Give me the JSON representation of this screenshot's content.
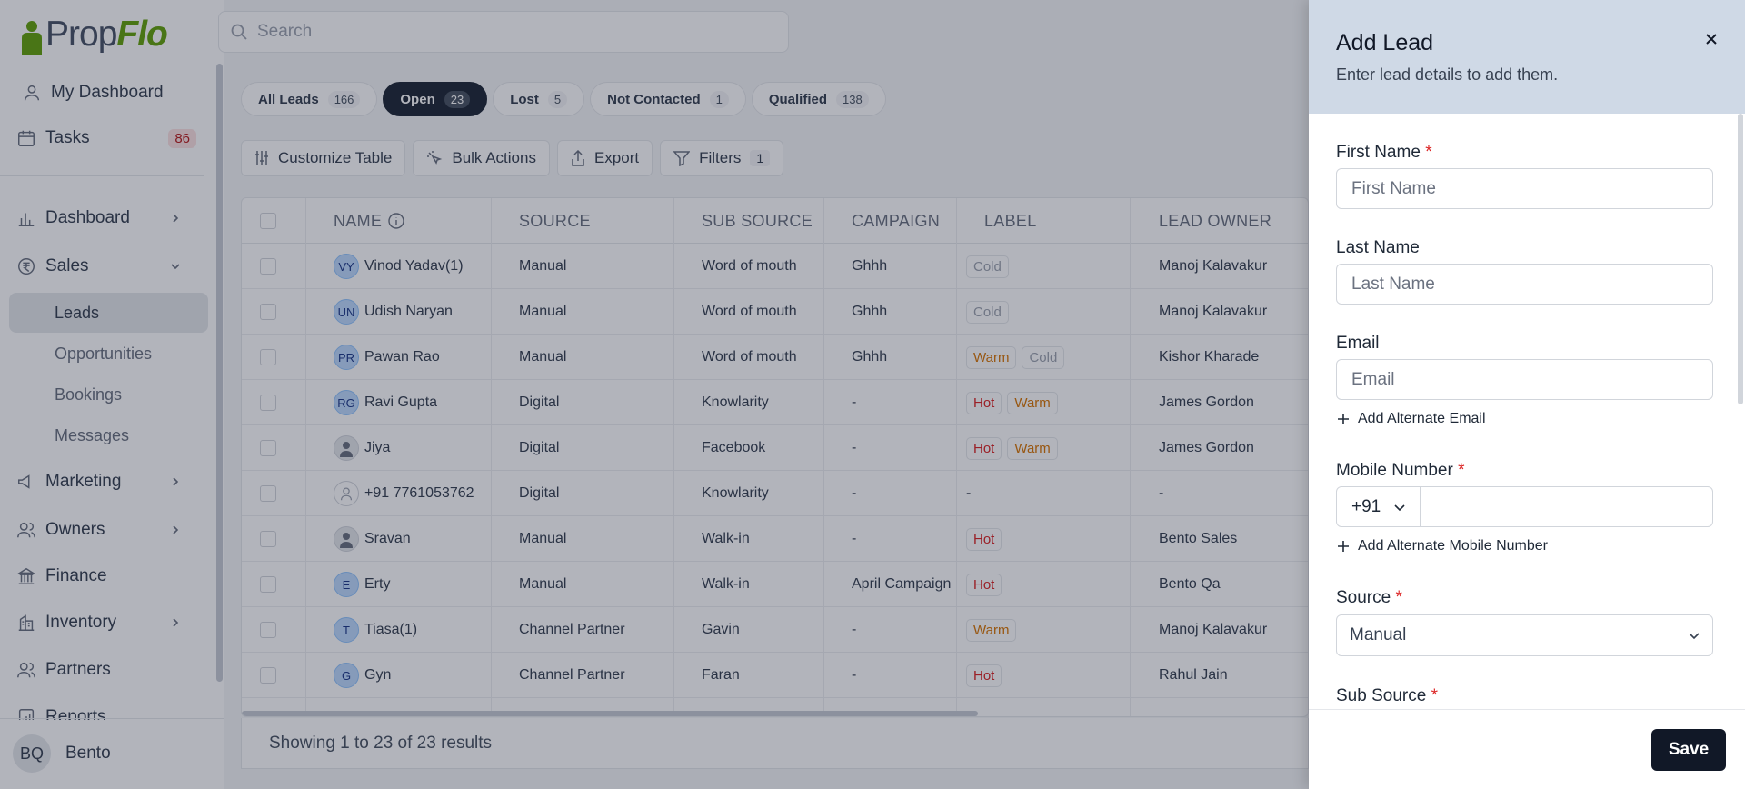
{
  "app": {
    "logo_prop": "Prop",
    "logo_flo": "Flo"
  },
  "search": {
    "placeholder": "Search"
  },
  "sidebar": {
    "my_dashboard": "My Dashboard",
    "tasks": "Tasks",
    "tasks_count": "86",
    "dashboard": "Dashboard",
    "sales": "Sales",
    "sales_sub": [
      "Leads",
      "Opportunities",
      "Bookings",
      "Messages"
    ],
    "marketing": "Marketing",
    "owners": "Owners",
    "finance": "Finance",
    "inventory": "Inventory",
    "partners": "Partners",
    "reports": "Reports",
    "user_initials": "BQ",
    "user_name": "Bento"
  },
  "tabs": [
    {
      "label": "All Leads",
      "count": "166",
      "active": false
    },
    {
      "label": "Open",
      "count": "23",
      "active": true
    },
    {
      "label": "Lost",
      "count": "5",
      "active": false
    },
    {
      "label": "Not Contacted",
      "count": "1",
      "active": false
    },
    {
      "label": "Qualified",
      "count": "138",
      "active": false
    }
  ],
  "toolbar": {
    "customize": "Customize Table",
    "bulk": "Bulk Actions",
    "export": "Export",
    "filters": "Filters",
    "filters_count": "1"
  },
  "table": {
    "headers": [
      "NAME",
      "SOURCE",
      "SUB SOURCE",
      "CAMPAIGN",
      "LABEL",
      "LEAD OWNER"
    ],
    "rows": [
      {
        "initials": "VY",
        "name": "Vinod Yadav(1)",
        "source": "Manual",
        "sub_source": "Word of mouth",
        "campaign": "Ghhh",
        "labels": [
          "Cold"
        ],
        "owner": "Manoj Kalavakur"
      },
      {
        "initials": "UN",
        "name": "Udish Naryan",
        "source": "Manual",
        "sub_source": "Word of mouth",
        "campaign": "Ghhh",
        "labels": [
          "Cold"
        ],
        "owner": "Manoj Kalavakur"
      },
      {
        "initials": "PR",
        "name": "Pawan Rao",
        "source": "Manual",
        "sub_source": "Word of mouth",
        "campaign": "Ghhh",
        "labels": [
          "Warm",
          "Cold"
        ],
        "owner": "Kishor Kharade"
      },
      {
        "initials": "RG",
        "name": "Ravi Gupta",
        "source": "Digital",
        "sub_source": "Knowlarity",
        "campaign": "-",
        "labels": [
          "Hot",
          "Warm"
        ],
        "owner": "James Gordon"
      },
      {
        "initials": "",
        "avatar": "photo",
        "name": "Jiya",
        "source": "Digital",
        "sub_source": "Facebook",
        "campaign": "-",
        "labels": [
          "Hot",
          "Warm"
        ],
        "owner": "James Gordon"
      },
      {
        "initials": "",
        "avatar": "person",
        "name": "+91 7761053762",
        "source": "Digital",
        "sub_source": "Knowlarity",
        "campaign": "-",
        "labels": [],
        "label_text": "-",
        "owner": "-"
      },
      {
        "initials": "",
        "avatar": "photo",
        "name": "Sravan",
        "source": "Manual",
        "sub_source": "Walk-in",
        "campaign": "-",
        "labels": [
          "Hot"
        ],
        "owner": "Bento Sales"
      },
      {
        "initials": "E",
        "name": "Erty",
        "source": "Manual",
        "sub_source": "Walk-in",
        "campaign": "April Campaign",
        "labels": [
          "Hot"
        ],
        "owner": "Bento Qa"
      },
      {
        "initials": "T",
        "name": "Tiasa(1)",
        "source": "Channel Partner",
        "sub_source": "Gavin",
        "campaign": "-",
        "labels": [
          "Warm"
        ],
        "owner": "Manoj Kalavakur"
      },
      {
        "initials": "G",
        "name": "Gyn",
        "source": "Channel Partner",
        "sub_source": "Faran",
        "campaign": "-",
        "labels": [
          "Hot"
        ],
        "owner": "Rahul Jain"
      }
    ],
    "footer": "Showing 1 to 23 of 23 results"
  },
  "drawer": {
    "title": "Add Lead",
    "subtitle": "Enter lead details to add them.",
    "first_name_label": "First Name",
    "first_name_placeholder": "First Name",
    "last_name_label": "Last Name",
    "last_name_placeholder": "Last Name",
    "email_label": "Email",
    "email_placeholder": "Email",
    "add_alt_email": "Add Alternate Email",
    "mobile_label": "Mobile Number",
    "country_code": "+91",
    "mobile_value": "",
    "add_alt_mobile": "Add Alternate Mobile Number",
    "source_label": "Source",
    "source_value": "Manual",
    "sub_source_label": "Sub Source",
    "required_mark": "*",
    "save": "Save"
  },
  "colors": {
    "accent": "#111827",
    "brand_green": "#65a30d",
    "required": "#dc2626",
    "drawer_header": "#cfd9e6"
  }
}
